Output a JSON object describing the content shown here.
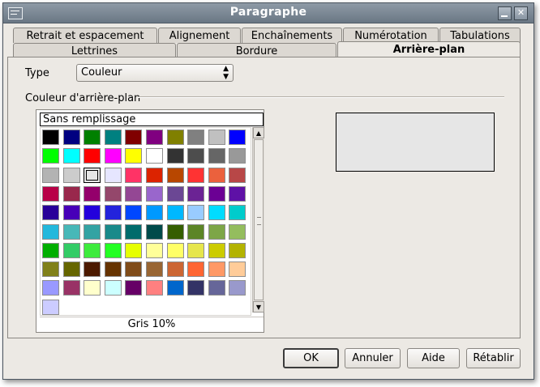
{
  "window": {
    "title": "Paragraphe"
  },
  "tabs_row1": [
    "Retrait et espacement",
    "Alignement",
    "Enchaînements",
    "Numérotation",
    "Tabulations"
  ],
  "tabs_row2": [
    "Lettrines",
    "Bordure",
    "Arrière-plan"
  ],
  "active_tab": "Arrière-plan",
  "type": {
    "label": "Type",
    "value": "Couleur"
  },
  "group_label": "Couleur d'arrière-plan",
  "none_option": "Sans remplissage",
  "selected_color_name": "Gris 10%",
  "preview_color": "#e6e6e6",
  "palette": [
    "#000000",
    "#000080",
    "#008000",
    "#008080",
    "#800000",
    "#800080",
    "#808000",
    "#808080",
    "#c0c0c0",
    "#0000ff",
    "#00ff00",
    "#00ffff",
    "#ff0000",
    "#ff00ff",
    "#ffff00",
    "#ffffff",
    "#333333",
    "#4d4d4d",
    "#666666",
    "#999999",
    "#b3b3b3",
    "#cccccc",
    "#e6e6e6",
    "#e6e6ff",
    "#ff3366",
    "#dc2300",
    "#b84700",
    "#ff3333",
    "#eb613d",
    "#b84747",
    "#b80047",
    "#99284c",
    "#94006b",
    "#94476b",
    "#944794",
    "#9966cc",
    "#6b4794",
    "#6b2394",
    "#6b0094",
    "#5e11a6",
    "#280099",
    "#4700b8",
    "#2300dc",
    "#2323dc",
    "#0047ff",
    "#0099ff",
    "#00b8ff",
    "#99ccff",
    "#00dcff",
    "#00cccc",
    "#23b8dc",
    "#47b8b8",
    "#33a3a3",
    "#198a8a",
    "#006b6b",
    "#004a4a",
    "#355e00",
    "#5c8526",
    "#7da647",
    "#94bd5e",
    "#00ae00",
    "#33cc66",
    "#3deb3d",
    "#23ff23",
    "#e6ff00",
    "#ffff99",
    "#ffff66",
    "#e6e64c",
    "#cccc00",
    "#b3b300",
    "#808019",
    "#666600",
    "#4c1900",
    "#663300",
    "#804c19",
    "#996633",
    "#cc6633",
    "#ff6633",
    "#ff9966",
    "#ffcc99",
    "#9999ff",
    "#993366",
    "#ffffcc",
    "#ccffff",
    "#660066",
    "#ff8080",
    "#0066cc",
    "#333366",
    "#666699",
    "#9999cc",
    "#ccccff"
  ],
  "buttons": {
    "ok": "OK",
    "cancel": "Annuler",
    "help": "Aide",
    "reset": "Rétablir"
  }
}
